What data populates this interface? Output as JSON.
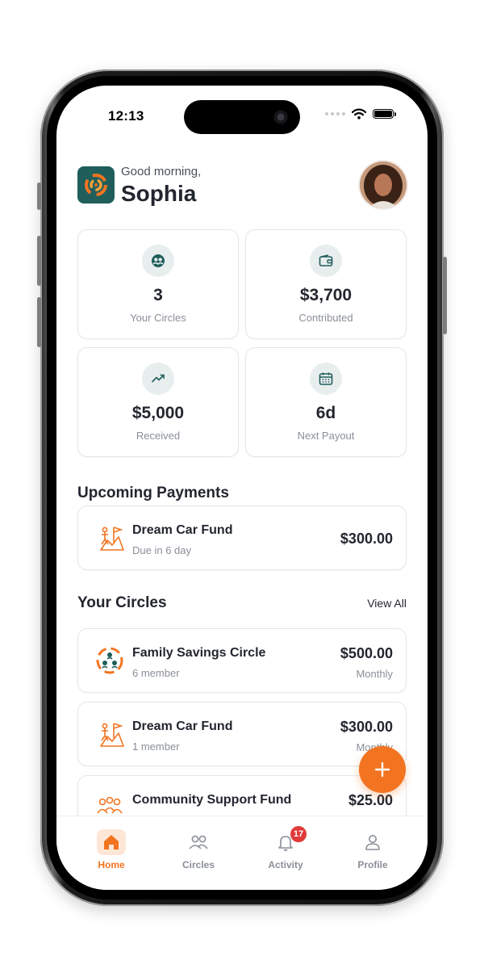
{
  "status_bar": {
    "time": "12:13"
  },
  "header": {
    "greeting": "Good morning,",
    "name": "Sophia"
  },
  "stats": [
    {
      "icon": "group-icon",
      "value": "3",
      "label": "Your Circles"
    },
    {
      "icon": "wallet-icon",
      "value": "$3,700",
      "label": "Contributed"
    },
    {
      "icon": "trend-up-icon",
      "value": "$5,000",
      "label": "Received"
    },
    {
      "icon": "calendar-icon",
      "value": "6d",
      "label": "Next Payout"
    }
  ],
  "upcoming": {
    "title": "Upcoming Payments",
    "items": [
      {
        "icon": "flag-climber-icon",
        "name": "Dream Car Fund",
        "sub": "Due in 6 day",
        "amount": "$300.00"
      }
    ]
  },
  "circles": {
    "title": "Your Circles",
    "view_all": "View All",
    "items": [
      {
        "icon": "circle-network-icon",
        "name": "Family Savings Circle",
        "sub": "6 member",
        "amount": "$500.00",
        "freq": "Monthly"
      },
      {
        "icon": "flag-climber-icon",
        "name": "Dream Car Fund",
        "sub": "1 member",
        "amount": "$300.00",
        "freq": "Monthly"
      },
      {
        "icon": "community-icon",
        "name": "Community Support Fund",
        "sub": "",
        "amount": "$25.00",
        "freq": ""
      }
    ]
  },
  "tabs": [
    {
      "icon": "home-icon",
      "label": "Home",
      "active": true
    },
    {
      "icon": "users-icon",
      "label": "Circles",
      "active": false
    },
    {
      "icon": "bell-icon",
      "label": "Activity",
      "active": false,
      "badge": "17"
    },
    {
      "icon": "person-icon",
      "label": "Profile",
      "active": false
    }
  ],
  "colors": {
    "accent": "#f27420",
    "brand": "#1f5e5b",
    "badge": "#e03a3a"
  }
}
